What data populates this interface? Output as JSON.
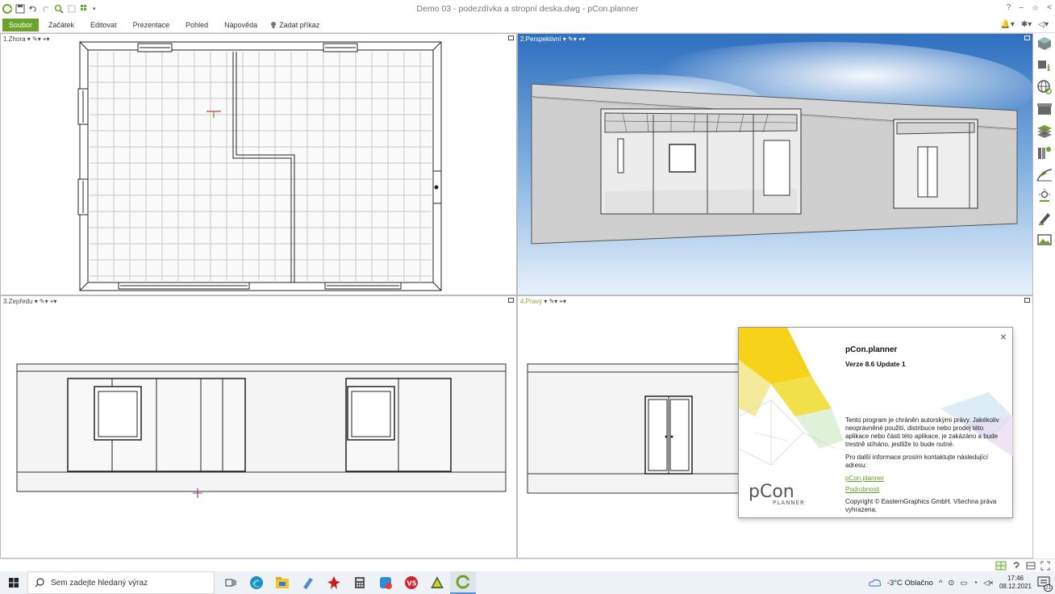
{
  "app": {
    "title": "Demo 03 - podezdívka a stropní deska.dwg - pCon.planner",
    "window_controls": [
      "?",
      "–",
      "☼",
      "<"
    ]
  },
  "ribbon": {
    "tabs": [
      {
        "label": "Soubor",
        "active": true
      },
      {
        "label": "Začátek"
      },
      {
        "label": "Editovat"
      },
      {
        "label": "Prezentace"
      },
      {
        "label": "Pohled"
      },
      {
        "label": "Nápověda"
      }
    ],
    "search_label": "Zadat příkaz"
  },
  "viewports": [
    {
      "label": "1.Zhora"
    },
    {
      "label": "2.Perspektivní"
    },
    {
      "label": "3.Zepředu"
    },
    {
      "label": "4.Pravý"
    }
  ],
  "about": {
    "title": "pCon.planner",
    "version": "Verze 8.6 Update 1",
    "notice": "Tento program je chráněn autorskými právy. Jakékoliv neoprávněné použití, distribuce nebo prodej této aplikace nebo části této aplikace, je zakázáno a bude trestně stíháno, jestliže to bude nutné.",
    "contact": "Pro další informace prosím kontaktujte následující adresu:",
    "link_site": "pCon.planner",
    "link_details": "Podrobnosti",
    "copyright": "Copyright © EasternGraphics GmbH. Všechna práva vyhrazena.",
    "logo_word": "pCon",
    "logo_sub": "PLANNER",
    "close_label": "×"
  },
  "taskbar": {
    "search_placeholder": "Sem zadejte hledaný výraz",
    "weather": "-3°C  Oblačno",
    "time": "17:46",
    "date": "08.12.2021",
    "notif_count": "21"
  },
  "colors": {
    "accent": "#6aa52a"
  }
}
